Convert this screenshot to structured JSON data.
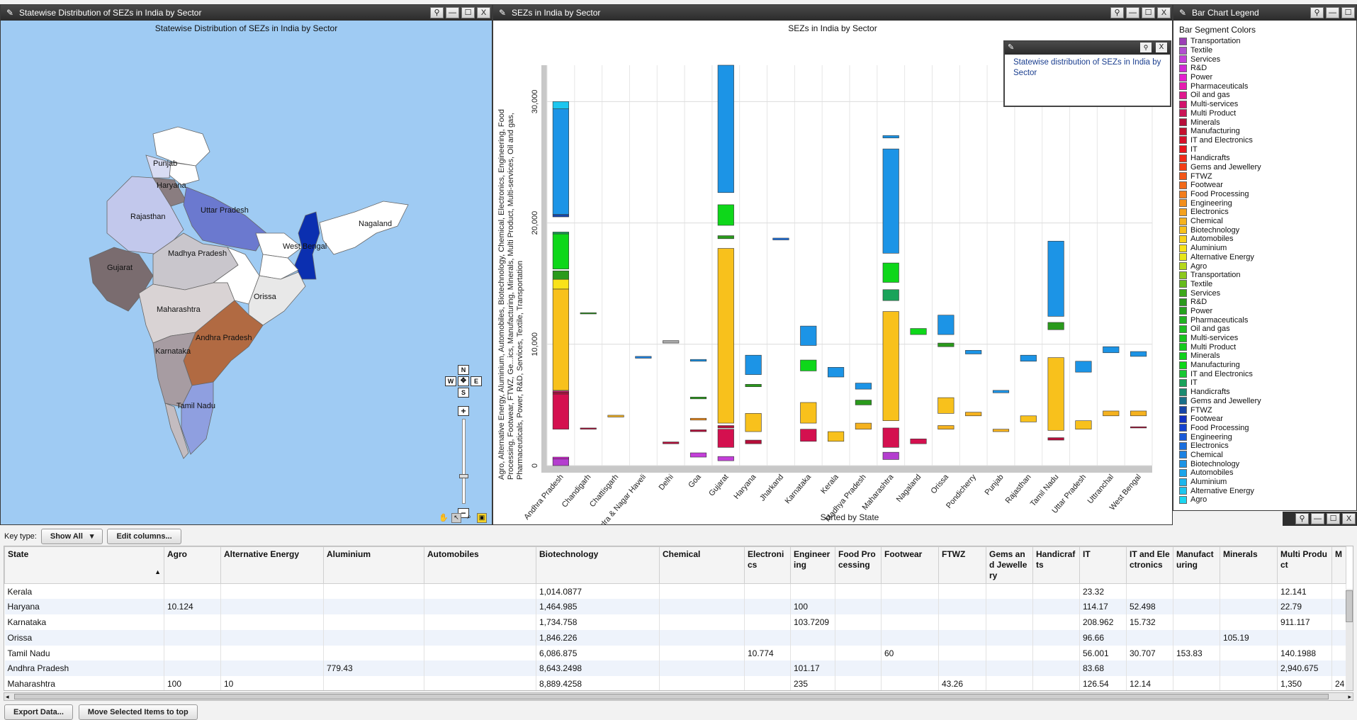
{
  "windows": {
    "map": {
      "title": "Statewise Distribution of SEZs in India by Sector",
      "heading": "Statewise Distribution of SEZs in India by Sector"
    },
    "chart": {
      "title": "SEZs in India by Sector",
      "heading": "SEZs in India by Sector"
    },
    "legend": {
      "title": "Bar Chart Legend",
      "heading": "Bar Segment Colors"
    },
    "note": {
      "text": "Statewise distribution of SEZs in India by Sector"
    }
  },
  "window_buttons": {
    "pin": "⚲",
    "minimize": "—",
    "maximize": "☐",
    "close": "X"
  },
  "map_labels": [
    {
      "name": "Punjab",
      "color": "#d8dcf3"
    },
    {
      "name": "Haryana",
      "color": "#8a7d80"
    },
    {
      "name": "Rajasthan",
      "color": "#c2c8ec"
    },
    {
      "name": "Uttar Pradesh",
      "color": "#6b79cf"
    },
    {
      "name": "Gujarat",
      "color": "#7a6c6f"
    },
    {
      "name": "Madhya Pradesh",
      "color": "#c9c6cc"
    },
    {
      "name": "West Bengal",
      "color": "#0b2fb0"
    },
    {
      "name": "Nagaland",
      "color": "#ffffff"
    },
    {
      "name": "Orissa",
      "color": "#e8e8e8"
    },
    {
      "name": "Maharashtra",
      "color": "#d9d3d4"
    },
    {
      "name": "Andhra Pradesh",
      "color": "#b16a42"
    },
    {
      "name": "Karnataka",
      "color": "#a79ca2"
    },
    {
      "name": "Tamil Nadu",
      "color": "#8f9fe0"
    }
  ],
  "map_nav": {
    "n": "N",
    "s": "S",
    "e": "E",
    "w": "W",
    "zoom_in": "+",
    "zoom_out": "−"
  },
  "legend_items": [
    {
      "label": "Transportation",
      "color": "#9c3fb6"
    },
    {
      "label": "Textile",
      "color": "#b14fd0"
    },
    {
      "label": "Services",
      "color": "#c43fd9"
    },
    {
      "label": "R&D",
      "color": "#d12ad6"
    },
    {
      "label": "Power",
      "color": "#e51fd0"
    },
    {
      "label": "Pharmaceuticals",
      "color": "#e61cb0"
    },
    {
      "label": "Oil and gas",
      "color": "#e0188e"
    },
    {
      "label": "Multi-services",
      "color": "#d2126c"
    },
    {
      "label": "Multi Product",
      "color": "#c91456"
    },
    {
      "label": "Minerals",
      "color": "#b60e3a"
    },
    {
      "label": "Manufacturing",
      "color": "#c4102e"
    },
    {
      "label": "IT and Electronics",
      "color": "#d6102a"
    },
    {
      "label": "IT",
      "color": "#e8151d"
    },
    {
      "label": "Handicrafts",
      "color": "#f02a18"
    },
    {
      "label": "Gems and Jewellery",
      "color": "#f43e16"
    },
    {
      "label": "FTWZ",
      "color": "#f45618"
    },
    {
      "label": "Footwear",
      "color": "#f36a1a"
    },
    {
      "label": "Food Processing",
      "color": "#f37d1c"
    },
    {
      "label": "Engineering",
      "color": "#f38f1d"
    },
    {
      "label": "Electronics",
      "color": "#f4a11e"
    },
    {
      "label": "Chemical",
      "color": "#f5b21f"
    },
    {
      "label": "Biotechnology",
      "color": "#f8c11c"
    },
    {
      "label": "Automobiles",
      "color": "#f9d21a"
    },
    {
      "label": "Aluminium",
      "color": "#f9e21a"
    },
    {
      "label": "Alternative Energy",
      "color": "#e8e61a"
    },
    {
      "label": "Agro",
      "color": "#b5d81a"
    },
    {
      "label": "Transportation",
      "color": "#8cc81c"
    },
    {
      "label": "Textile",
      "color": "#66bb1c"
    },
    {
      "label": "Services",
      "color": "#3ea81c"
    },
    {
      "label": "R&D",
      "color": "#2a9a1c"
    },
    {
      "label": "Power",
      "color": "#25a31e"
    },
    {
      "label": "Pharmaceuticals",
      "color": "#22b322"
    },
    {
      "label": "Oil and gas",
      "color": "#1fbd22"
    },
    {
      "label": "Multi-services",
      "color": "#18c41f"
    },
    {
      "label": "Multi Product",
      "color": "#14cb1d"
    },
    {
      "label": "Minerals",
      "color": "#10d21b"
    },
    {
      "label": "Manufacturing",
      "color": "#0ed71a"
    },
    {
      "label": "IT and Electronics",
      "color": "#19c833"
    },
    {
      "label": "IT",
      "color": "#1aa35a"
    },
    {
      "label": "Handicrafts",
      "color": "#1b8b71"
    },
    {
      "label": "Gems and Jewellery",
      "color": "#1a6f8a"
    },
    {
      "label": "FTWZ",
      "color": "#1845a8"
    },
    {
      "label": "Footwear",
      "color": "#1231c2"
    },
    {
      "label": "Food Processing",
      "color": "#1543d0"
    },
    {
      "label": "Engineering",
      "color": "#1a5ad8"
    },
    {
      "label": "Electronics",
      "color": "#1b6fde"
    },
    {
      "label": "Chemical",
      "color": "#1c82e2"
    },
    {
      "label": "Biotechnology",
      "color": "#1c94e6"
    },
    {
      "label": "Automobiles",
      "color": "#1ca5ea"
    },
    {
      "label": "Aluminium",
      "color": "#1cb6ed"
    },
    {
      "label": "Alternative Energy",
      "color": "#1cc6ef"
    },
    {
      "label": "Agro",
      "color": "#1cd6f0"
    }
  ],
  "chart_data": {
    "type": "bar",
    "title": "SEZs in India by Sector",
    "xlabel": "Sorted by State",
    "ylabel": "Agro, Alternative Energy, Aluminium, Automobiles, Biotechnology, Chemical, Electronics, Engineering, Food Processing, Footwear, FTWZ, Ge...ics, Manufacturing, Minerals, Multi Product, Multi-services, Oil and gas, Pharmaceuticals, Power, R&D, Services, Textile, Transportation",
    "ylim": [
      0,
      33000
    ],
    "yticks": [
      0,
      10000,
      20000,
      30000
    ],
    "ytick_labels": [
      "0",
      "10,000",
      "20,000",
      "30,000"
    ],
    "categories": [
      "Andhra Pradesh",
      "Chandigarh",
      "Chattisgarh",
      "Dadra & Nagar Haveli",
      "Delhi",
      "Goa",
      "Gujarat",
      "Haryana",
      "Jharkand",
      "Karnataka",
      "Kerala",
      "Madhya Pradesh",
      "Maharashtra",
      "Nagaland",
      "Orissa",
      "Pondicherry",
      "Punjab",
      "Rajasthan",
      "Tamil Nadu",
      "Uttar Pradesh",
      "Uttranchal",
      "West Bengal"
    ],
    "segments": [
      [
        [
          0,
          550,
          "#b43ecf"
        ],
        [
          550,
          700,
          "#d020d0"
        ],
        [
          3000,
          5900,
          "#d4104f"
        ],
        [
          5900,
          6050,
          "#b60e3a"
        ],
        [
          6050,
          6150,
          "#d2126c"
        ],
        [
          6200,
          14550,
          "#f8c11c"
        ],
        [
          14550,
          15350,
          "#f9e21a"
        ],
        [
          15350,
          16050,
          "#2a9a1c"
        ],
        [
          16200,
          19100,
          "#0ed71a"
        ],
        [
          19100,
          19250,
          "#1aa35a"
        ],
        [
          20500,
          20700,
          "#1845a8"
        ],
        [
          20700,
          29400,
          "#1c94e6"
        ],
        [
          29400,
          30000,
          "#1cc6ef"
        ]
      ],
      [
        [
          3000,
          3100,
          "#b60e3a"
        ],
        [
          12500,
          12600,
          "#2a9a1c"
        ]
      ],
      [
        [
          4000,
          4150,
          "#f5b21f"
        ]
      ],
      [
        [
          8850,
          9000,
          "#1c82e2"
        ]
      ],
      [
        [
          1800,
          1950,
          "#b60e3a"
        ],
        [
          10100,
          10300,
          "#a8a8a8"
        ]
      ],
      [
        [
          700,
          1050,
          "#c43fd9"
        ],
        [
          2800,
          2950,
          "#b60e3a"
        ],
        [
          3750,
          3900,
          "#f38f1d"
        ],
        [
          5500,
          5650,
          "#2a9a1c"
        ],
        [
          8600,
          8750,
          "#1c94e6"
        ]
      ],
      [
        [
          400,
          750,
          "#c43fd9"
        ],
        [
          1500,
          3000,
          "#d4104f"
        ],
        [
          3100,
          3300,
          "#b60e3a"
        ],
        [
          3500,
          17900,
          "#f8c11c"
        ],
        [
          18700,
          18950,
          "#2a9a1c"
        ],
        [
          19800,
          21500,
          "#0ed71a"
        ],
        [
          22500,
          33000,
          "#1c94e6"
        ]
      ],
      [
        [
          1800,
          2100,
          "#b60e3a"
        ],
        [
          2800,
          4300,
          "#f8c11c"
        ],
        [
          6500,
          6700,
          "#2a9a1c"
        ],
        [
          7500,
          9100,
          "#1c94e6"
        ]
      ],
      [
        [
          18600,
          18750,
          "#1b6fde"
        ]
      ],
      [
        [
          2000,
          3000,
          "#d4104f"
        ],
        [
          3500,
          5200,
          "#f8c11c"
        ],
        [
          7800,
          8700,
          "#0ed71a"
        ],
        [
          9900,
          11500,
          "#1c94e6"
        ]
      ],
      [
        [
          2000,
          2800,
          "#f8c11c"
        ],
        [
          7300,
          8100,
          "#1c94e6"
        ]
      ],
      [
        [
          3000,
          3500,
          "#f5b21f"
        ],
        [
          5000,
          5400,
          "#2a9a1c"
        ],
        [
          6300,
          6800,
          "#1c94e6"
        ]
      ],
      [
        [
          500,
          1100,
          "#b43ecf"
        ],
        [
          1500,
          3100,
          "#d4104f"
        ],
        [
          3700,
          12700,
          "#f8c11c"
        ],
        [
          13600,
          14500,
          "#1aa35a"
        ],
        [
          15100,
          16700,
          "#0ed71a"
        ],
        [
          17500,
          26100,
          "#1c94e6"
        ],
        [
          27000,
          27200,
          "#1c94e6"
        ]
      ],
      [
        [
          1800,
          2200,
          "#d4104f"
        ],
        [
          10800,
          11300,
          "#0ed71a"
        ]
      ],
      [
        [
          3000,
          3300,
          "#f5b21f"
        ],
        [
          4300,
          5600,
          "#f8c11c"
        ],
        [
          9800,
          10100,
          "#2a9a1c"
        ],
        [
          10800,
          12400,
          "#1c94e6"
        ]
      ],
      [
        [
          4100,
          4400,
          "#f5b21f"
        ],
        [
          9200,
          9500,
          "#1c94e6"
        ]
      ],
      [
        [
          2800,
          3000,
          "#f5b21f"
        ],
        [
          6000,
          6200,
          "#1c94e6"
        ]
      ],
      [
        [
          3600,
          4100,
          "#f8c11c"
        ],
        [
          8600,
          9100,
          "#1c94e6"
        ]
      ],
      [
        [
          2100,
          2300,
          "#b60e3a"
        ],
        [
          2900,
          8900,
          "#f8c11c"
        ],
        [
          11200,
          11800,
          "#2a9a1c"
        ],
        [
          12300,
          18500,
          "#1c94e6"
        ]
      ],
      [
        [
          3000,
          3700,
          "#f8c11c"
        ],
        [
          7700,
          8600,
          "#1c94e6"
        ]
      ],
      [
        [
          4100,
          4500,
          "#f5b21f"
        ],
        [
          9300,
          9800,
          "#1c94e6"
        ]
      ],
      [
        [
          3100,
          3200,
          "#b60e3a"
        ],
        [
          4100,
          4500,
          "#f5b21f"
        ],
        [
          9000,
          9400,
          "#1c94e6"
        ]
      ]
    ]
  },
  "table": {
    "key_type_label": "Key type:",
    "key_type_value": "Show All",
    "edit_columns_label": "Edit columns...",
    "export_label": "Export Data...",
    "move_label": "Move Selected Items to top",
    "columns": [
      "State",
      "Agro",
      "Alternative Energy",
      "Aluminium",
      "Automobiles",
      "Biotechnology",
      "Chemical",
      "Electronics",
      "Engineering",
      "Food Processing",
      "Footwear",
      "FTWZ",
      "Gems and Jewellery",
      "Handicrafts",
      "IT",
      "IT and Electronics",
      "Manufacturing",
      "Minerals",
      "Multi Product",
      "M"
    ],
    "rows": [
      [
        "Kerala",
        "",
        "",
        "",
        "",
        "1,014.0877",
        "",
        "",
        "",
        "",
        "",
        "",
        "",
        "",
        "23.32",
        "",
        "",
        "",
        "12.141",
        ""
      ],
      [
        "Haryana",
        "10.124",
        "",
        "",
        "",
        "1,464.985",
        "",
        "",
        "100",
        "",
        "",
        "",
        "",
        "",
        "114.17",
        "52.498",
        "",
        "",
        "22.79",
        ""
      ],
      [
        "Karnataka",
        "",
        "",
        "",
        "",
        "1,734.758",
        "",
        "",
        "103.7209",
        "",
        "",
        "",
        "",
        "",
        "208.962",
        "15.732",
        "",
        "",
        "911.117",
        ""
      ],
      [
        "Orissa",
        "",
        "",
        "",
        "",
        "1,846.226",
        "",
        "",
        "",
        "",
        "",
        "",
        "",
        "",
        "96.66",
        "",
        "",
        "105.19",
        "",
        ""
      ],
      [
        "Tamil Nadu",
        "",
        "",
        "",
        "",
        "6,086.875",
        "",
        "10.774",
        "",
        "",
        "60",
        "",
        "",
        "",
        "56.001",
        "30.707",
        "153.83",
        "",
        "140.1988",
        ""
      ],
      [
        "Andhra Pradesh",
        "",
        "",
        "779.43",
        "",
        "8,643.2498",
        "",
        "",
        "101.17",
        "",
        "",
        "",
        "",
        "",
        "83.68",
        "",
        "",
        "",
        "2,940.675",
        ""
      ],
      [
        "Maharashtra",
        "100",
        "10",
        "",
        "",
        "8,889.4258",
        "",
        "",
        "235",
        "",
        "",
        "43.26",
        "",
        "",
        "126.54",
        "12.14",
        "",
        "",
        "1,350",
        "24"
      ]
    ]
  }
}
